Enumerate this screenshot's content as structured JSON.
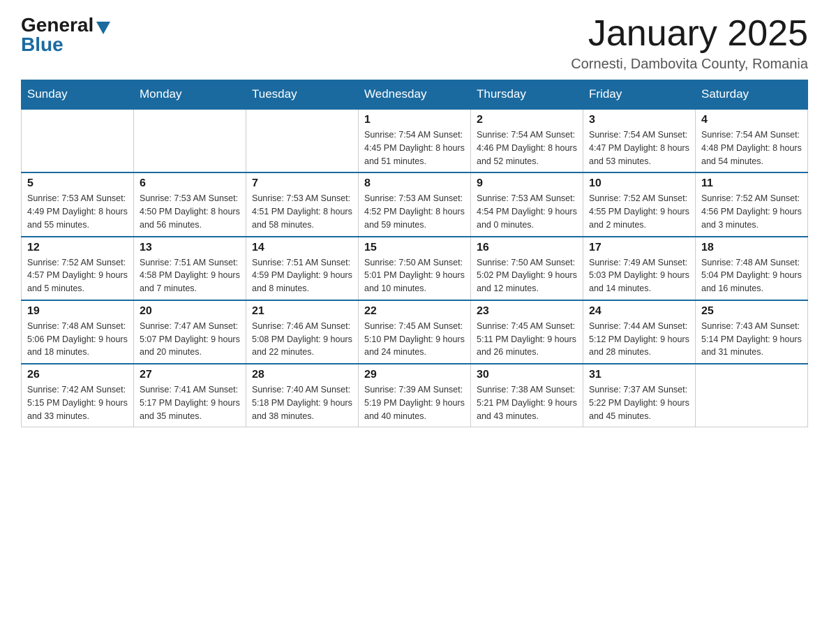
{
  "logo": {
    "general": "General",
    "blue": "Blue"
  },
  "title": "January 2025",
  "location": "Cornesti, Dambovita County, Romania",
  "days_of_week": [
    "Sunday",
    "Monday",
    "Tuesday",
    "Wednesday",
    "Thursday",
    "Friday",
    "Saturday"
  ],
  "weeks": [
    [
      {
        "day": "",
        "info": ""
      },
      {
        "day": "",
        "info": ""
      },
      {
        "day": "",
        "info": ""
      },
      {
        "day": "1",
        "info": "Sunrise: 7:54 AM\nSunset: 4:45 PM\nDaylight: 8 hours\nand 51 minutes."
      },
      {
        "day": "2",
        "info": "Sunrise: 7:54 AM\nSunset: 4:46 PM\nDaylight: 8 hours\nand 52 minutes."
      },
      {
        "day": "3",
        "info": "Sunrise: 7:54 AM\nSunset: 4:47 PM\nDaylight: 8 hours\nand 53 minutes."
      },
      {
        "day": "4",
        "info": "Sunrise: 7:54 AM\nSunset: 4:48 PM\nDaylight: 8 hours\nand 54 minutes."
      }
    ],
    [
      {
        "day": "5",
        "info": "Sunrise: 7:53 AM\nSunset: 4:49 PM\nDaylight: 8 hours\nand 55 minutes."
      },
      {
        "day": "6",
        "info": "Sunrise: 7:53 AM\nSunset: 4:50 PM\nDaylight: 8 hours\nand 56 minutes."
      },
      {
        "day": "7",
        "info": "Sunrise: 7:53 AM\nSunset: 4:51 PM\nDaylight: 8 hours\nand 58 minutes."
      },
      {
        "day": "8",
        "info": "Sunrise: 7:53 AM\nSunset: 4:52 PM\nDaylight: 8 hours\nand 59 minutes."
      },
      {
        "day": "9",
        "info": "Sunrise: 7:53 AM\nSunset: 4:54 PM\nDaylight: 9 hours\nand 0 minutes."
      },
      {
        "day": "10",
        "info": "Sunrise: 7:52 AM\nSunset: 4:55 PM\nDaylight: 9 hours\nand 2 minutes."
      },
      {
        "day": "11",
        "info": "Sunrise: 7:52 AM\nSunset: 4:56 PM\nDaylight: 9 hours\nand 3 minutes."
      }
    ],
    [
      {
        "day": "12",
        "info": "Sunrise: 7:52 AM\nSunset: 4:57 PM\nDaylight: 9 hours\nand 5 minutes."
      },
      {
        "day": "13",
        "info": "Sunrise: 7:51 AM\nSunset: 4:58 PM\nDaylight: 9 hours\nand 7 minutes."
      },
      {
        "day": "14",
        "info": "Sunrise: 7:51 AM\nSunset: 4:59 PM\nDaylight: 9 hours\nand 8 minutes."
      },
      {
        "day": "15",
        "info": "Sunrise: 7:50 AM\nSunset: 5:01 PM\nDaylight: 9 hours\nand 10 minutes."
      },
      {
        "day": "16",
        "info": "Sunrise: 7:50 AM\nSunset: 5:02 PM\nDaylight: 9 hours\nand 12 minutes."
      },
      {
        "day": "17",
        "info": "Sunrise: 7:49 AM\nSunset: 5:03 PM\nDaylight: 9 hours\nand 14 minutes."
      },
      {
        "day": "18",
        "info": "Sunrise: 7:48 AM\nSunset: 5:04 PM\nDaylight: 9 hours\nand 16 minutes."
      }
    ],
    [
      {
        "day": "19",
        "info": "Sunrise: 7:48 AM\nSunset: 5:06 PM\nDaylight: 9 hours\nand 18 minutes."
      },
      {
        "day": "20",
        "info": "Sunrise: 7:47 AM\nSunset: 5:07 PM\nDaylight: 9 hours\nand 20 minutes."
      },
      {
        "day": "21",
        "info": "Sunrise: 7:46 AM\nSunset: 5:08 PM\nDaylight: 9 hours\nand 22 minutes."
      },
      {
        "day": "22",
        "info": "Sunrise: 7:45 AM\nSunset: 5:10 PM\nDaylight: 9 hours\nand 24 minutes."
      },
      {
        "day": "23",
        "info": "Sunrise: 7:45 AM\nSunset: 5:11 PM\nDaylight: 9 hours\nand 26 minutes."
      },
      {
        "day": "24",
        "info": "Sunrise: 7:44 AM\nSunset: 5:12 PM\nDaylight: 9 hours\nand 28 minutes."
      },
      {
        "day": "25",
        "info": "Sunrise: 7:43 AM\nSunset: 5:14 PM\nDaylight: 9 hours\nand 31 minutes."
      }
    ],
    [
      {
        "day": "26",
        "info": "Sunrise: 7:42 AM\nSunset: 5:15 PM\nDaylight: 9 hours\nand 33 minutes."
      },
      {
        "day": "27",
        "info": "Sunrise: 7:41 AM\nSunset: 5:17 PM\nDaylight: 9 hours\nand 35 minutes."
      },
      {
        "day": "28",
        "info": "Sunrise: 7:40 AM\nSunset: 5:18 PM\nDaylight: 9 hours\nand 38 minutes."
      },
      {
        "day": "29",
        "info": "Sunrise: 7:39 AM\nSunset: 5:19 PM\nDaylight: 9 hours\nand 40 minutes."
      },
      {
        "day": "30",
        "info": "Sunrise: 7:38 AM\nSunset: 5:21 PM\nDaylight: 9 hours\nand 43 minutes."
      },
      {
        "day": "31",
        "info": "Sunrise: 7:37 AM\nSunset: 5:22 PM\nDaylight: 9 hours\nand 45 minutes."
      },
      {
        "day": "",
        "info": ""
      }
    ]
  ]
}
